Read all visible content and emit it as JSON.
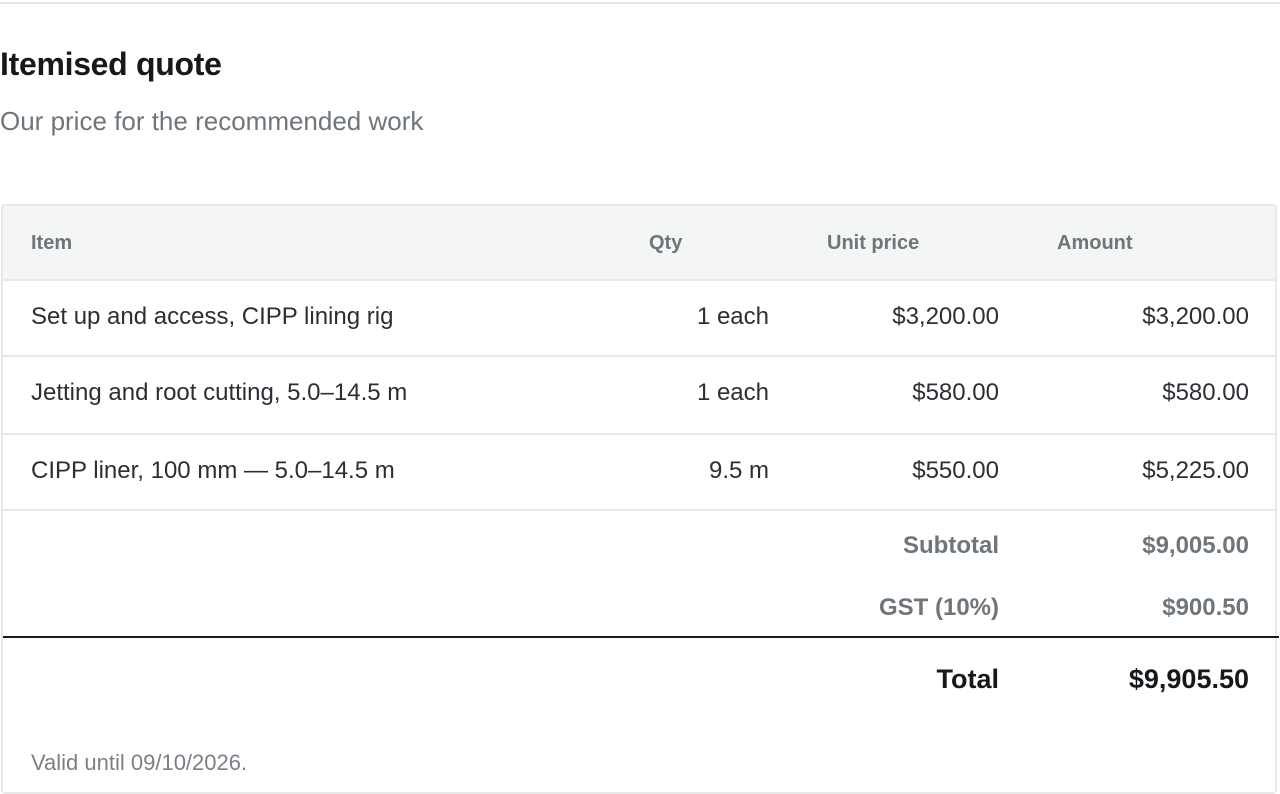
{
  "header": {
    "title": "Itemised quote",
    "subtitle": "Our price for the recommended work"
  },
  "table": {
    "columns": [
      "Item",
      "Qty",
      "Unit price",
      "Amount"
    ],
    "rows": [
      {
        "item": "Set up and access, CIPP lining rig",
        "qty": "1 each",
        "unit_price": "$3,200.00",
        "amount": "$3,200.00"
      },
      {
        "item": "Jetting and root cutting, 5.0–14.5 m",
        "qty": "1 each",
        "unit_price": "$580.00",
        "amount": "$580.00"
      },
      {
        "item": "CIPP liner, 100 mm — 5.0–14.5 m",
        "qty": "9.5 m",
        "unit_price": "$550.00",
        "amount": "$5,225.00"
      }
    ]
  },
  "summary": {
    "subtotal_label": "Subtotal",
    "subtotal_value": "$9,005.00",
    "gst_label": "GST (10%)",
    "gst_value": "$900.50",
    "total_label": "Total",
    "total_value": "$9,905.50"
  },
  "footer": {
    "valid_until": "Valid until 09/10/2026."
  }
}
